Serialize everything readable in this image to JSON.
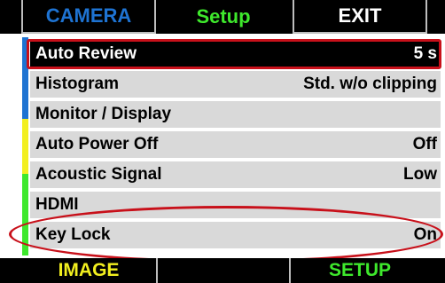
{
  "tabs": {
    "camera": "CAMERA",
    "setup": "Setup",
    "exit": "EXIT"
  },
  "menu": [
    {
      "label": "Auto Review",
      "value": "5 s",
      "selected": true
    },
    {
      "label": "Histogram",
      "value": "Std. w/o clipping"
    },
    {
      "label": "Monitor / Display",
      "value": ""
    },
    {
      "label": "Auto Power Off",
      "value": "Off"
    },
    {
      "label": "Acoustic Signal",
      "value": "Low"
    },
    {
      "label": "HDMI",
      "value": ""
    },
    {
      "label": "Key Lock",
      "value": "On"
    }
  ],
  "bottom": {
    "image": "IMAGE",
    "middle": "",
    "setup": "SETUP"
  },
  "colors": {
    "camera_tab": "#1e73d2",
    "setup_tab": "#3ee82c",
    "image_tab": "#f2ef1f",
    "highlight": "#c8101a",
    "strip_blue": "#1e73d2",
    "strip_yellow": "#f2ef1f",
    "strip_green": "#3ee82c"
  }
}
